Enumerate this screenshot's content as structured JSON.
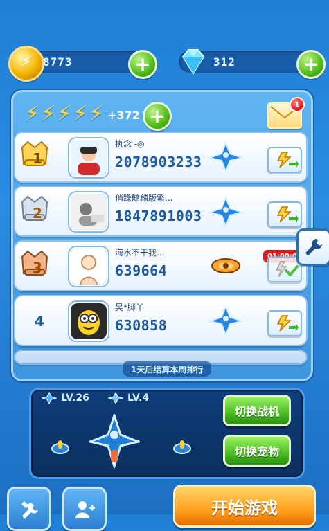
{
  "resources": {
    "coins": "8773",
    "diamonds": "312"
  },
  "energy": {
    "bonus": "+372"
  },
  "mail": {
    "unread_count": "1"
  },
  "leaderboard": {
    "rows": [
      {
        "rank": "1",
        "name": "执念 -◎",
        "score": "2078903233",
        "action": "send-energy"
      },
      {
        "rank": "2",
        "name": "俏躁髓麟版繁...",
        "score": "1847891003",
        "action": "send-energy"
      },
      {
        "rank": "3",
        "name": "海水不干我...",
        "score": "639664",
        "action": "sent",
        "timer": "01:00:01"
      },
      {
        "rank": "4",
        "name": "昊*脚丫",
        "score": "630858",
        "action": "send-energy"
      }
    ],
    "footer_hint": "1天后结算本周排行"
  },
  "loadout": {
    "plane_level": "LV.26",
    "wingman_level": "LV.4",
    "switch_plane_label": "切换战机",
    "switch_pet_label": "切换宠物"
  },
  "bottom": {
    "start_label": "开始游戏"
  },
  "colors": {
    "bg": "#2a8ce2",
    "panel": "#3e95de",
    "score": "#1b5aa1",
    "green": "#3fb31a",
    "orange": "#ff9d1a",
    "red": "#e01515"
  }
}
